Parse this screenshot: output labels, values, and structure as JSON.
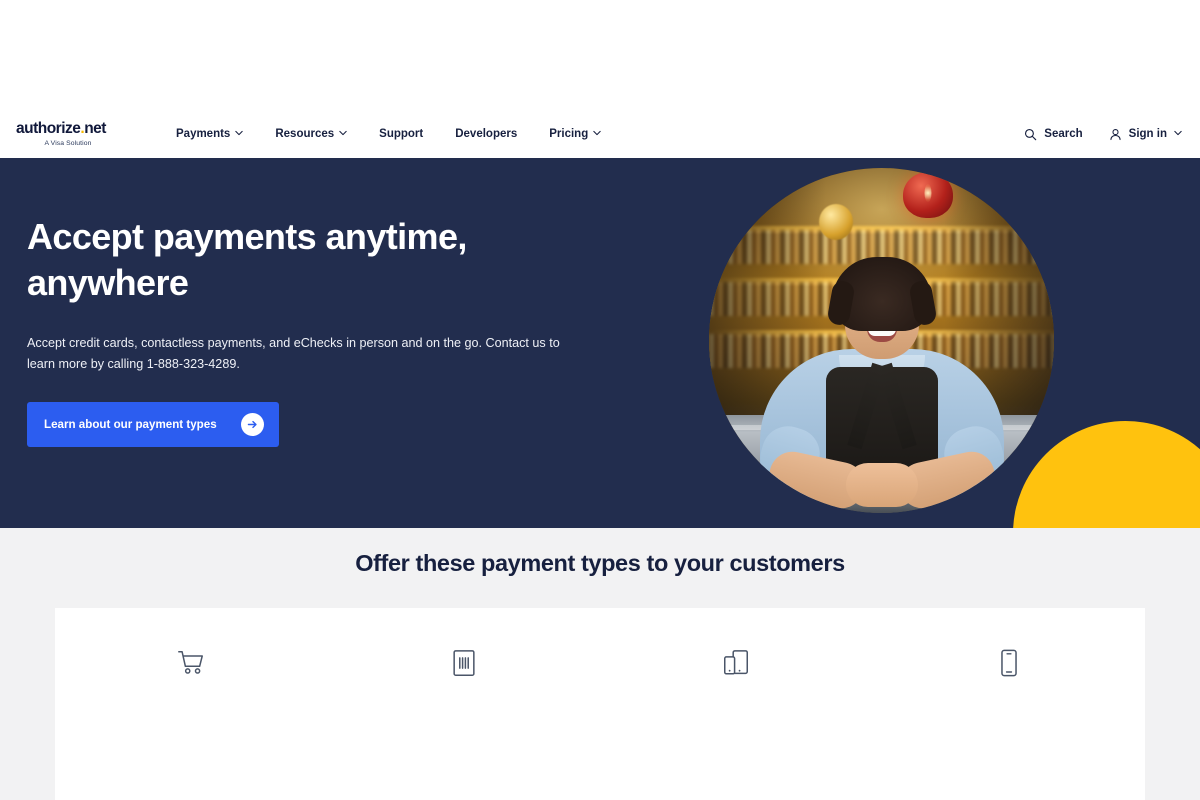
{
  "brand": {
    "logo_text": "authorize",
    "logo_dot": ".",
    "logo_suffix": "net",
    "logo_tagline": "A Visa Solution",
    "accent_yellow": "#ffc20e",
    "navy": "#222d4e",
    "blue": "#2c5df0"
  },
  "header": {
    "nav": [
      {
        "label": "Payments",
        "has_chevron": true
      },
      {
        "label": "Resources",
        "has_chevron": true
      },
      {
        "label": "Support",
        "has_chevron": false
      },
      {
        "label": "Developers",
        "has_chevron": false
      },
      {
        "label": "Pricing",
        "has_chevron": true
      }
    ],
    "search_label": "Search",
    "search_icon": "search-icon",
    "signin_label": "Sign in",
    "signin_icon": "user-icon",
    "signin_has_chevron": true
  },
  "hero": {
    "heading": "Accept payments anytime, anywhere",
    "paragraph": "Accept credit cards, contactless payments, and eChecks in person and on the go. Contact us to learn more by calling 1-888-323-4289.",
    "cta_label": "Learn about our payment types",
    "cta_icon": "arrow-right-circle-icon",
    "image_alt": "Smiling woman in denim shirt and apron leaning on a bar counter"
  },
  "payment_types_section": {
    "title": "Offer these payment types to your customers",
    "items": [
      {
        "icon": "shopping-cart-icon"
      },
      {
        "icon": "card-reader-icon"
      },
      {
        "icon": "devices-icon"
      },
      {
        "icon": "mobile-phone-icon"
      }
    ]
  }
}
